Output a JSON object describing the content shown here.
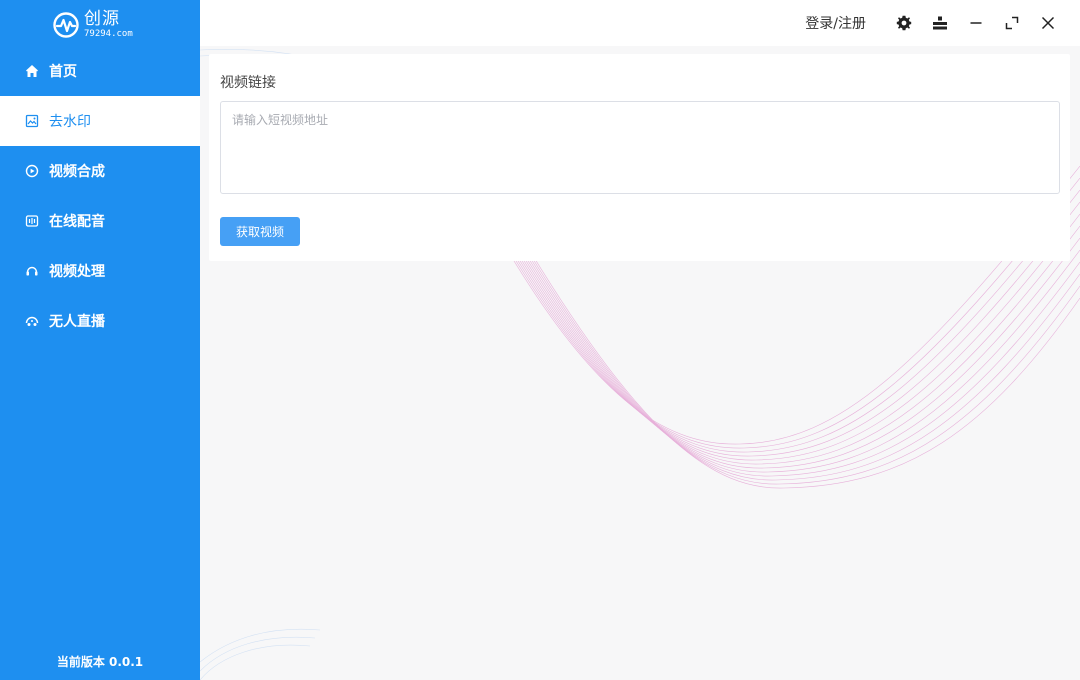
{
  "app": {
    "name": "创源",
    "site": "79294.com"
  },
  "sidebar": {
    "items": [
      {
        "label": "首页",
        "icon": "home-icon"
      },
      {
        "label": "去水印",
        "icon": "image-edit-icon",
        "active": true
      },
      {
        "label": "视频合成",
        "icon": "video-compose-icon"
      },
      {
        "label": "在线配音",
        "icon": "voice-icon"
      },
      {
        "label": "视频处理",
        "icon": "headset-icon"
      },
      {
        "label": "无人直播",
        "icon": "live-icon"
      }
    ],
    "version": "当前版本 0.0.1"
  },
  "topbar": {
    "login": "登录/注册",
    "icons": [
      "gear-icon",
      "toolbox-icon",
      "minimize-icon",
      "maximize-icon",
      "close-icon"
    ]
  },
  "main": {
    "field_label": "视频链接",
    "input_placeholder": "请输入短视频地址",
    "input_value": "",
    "button_label": "获取视频"
  },
  "colors": {
    "sidebar_bg": "#1e8ff0",
    "button_bg": "#46a0f5",
    "deco_line": "#e29ad0"
  }
}
